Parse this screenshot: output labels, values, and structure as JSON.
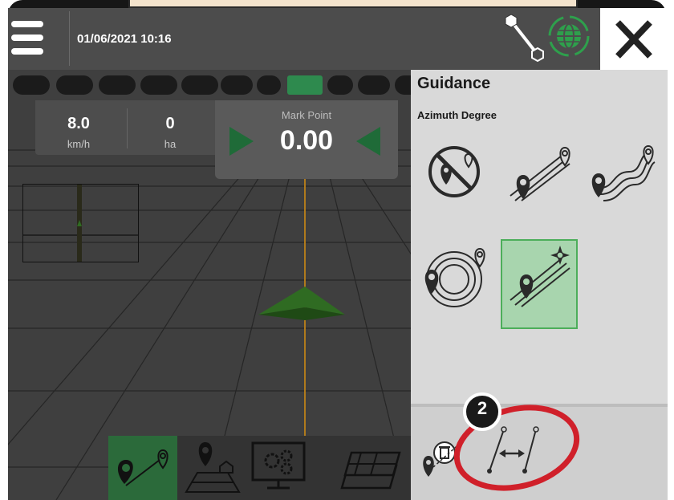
{
  "header": {
    "datetime": "01/06/2021 10:16"
  },
  "stats": {
    "speed_value": "8.0",
    "speed_unit": "km/h",
    "area_value": "0",
    "area_unit": "ha"
  },
  "mark_point": {
    "label": "Mark Point",
    "value": "0.00"
  },
  "panel": {
    "title": "Guidance",
    "subtitle": "Azimuth Degree",
    "modes": [
      {
        "name": "no-guidance",
        "selected": false
      },
      {
        "name": "straight-ab",
        "selected": false
      },
      {
        "name": "curved-ab",
        "selected": false
      },
      {
        "name": "circle-pivot",
        "selected": false
      },
      {
        "name": "azimuth-degree",
        "selected": true
      }
    ]
  },
  "callout": {
    "number": "2"
  },
  "colors": {
    "accent_green": "#2e8a4e",
    "selected_fill": "#a8d5ae",
    "selected_border": "#4cae5a",
    "callout_red": "#d0202a",
    "vehicle_green": "#2f6b22",
    "guide_line": "#c98a1e"
  },
  "icons": [
    "menu-icon",
    "ab-line-icon",
    "gnss-globe-icon",
    "close-icon",
    "boom-section-icon",
    "steer-left-arrow-icon",
    "steer-right-arrow-icon",
    "vehicle-icon",
    "guidance-mode-icon",
    "field-icon",
    "settings-icon",
    "layers-icon",
    "delete-line-icon",
    "shift-line-icon"
  ]
}
